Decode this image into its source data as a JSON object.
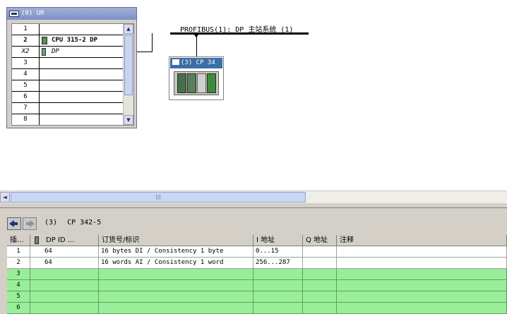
{
  "rack": {
    "title": "(0) UR",
    "rows": [
      {
        "slot": "1",
        "module": ""
      },
      {
        "slot": "2",
        "module": "CPU 315-2 DP",
        "icon": "cpu-module-icon"
      },
      {
        "slot": "X2",
        "module": "DP",
        "icon": "dp-interface-icon"
      },
      {
        "slot": "3",
        "module": ""
      },
      {
        "slot": "4",
        "module": ""
      },
      {
        "slot": "5",
        "module": ""
      },
      {
        "slot": "6",
        "module": ""
      },
      {
        "slot": "7",
        "module": ""
      },
      {
        "slot": "8",
        "module": ""
      }
    ]
  },
  "network": {
    "bus_label": "PROFIBUS(1): DP 主站系统 (1)",
    "slave_title": "(3) CP 34"
  },
  "detail": {
    "slot_number": "(3)",
    "module_name": "CP 342-5",
    "columns": [
      "插...",
      "DP ID ...",
      "订货号/标识",
      "I 地址",
      "Q 地址",
      "注释"
    ],
    "rows": [
      {
        "slot": "1",
        "dp_id": "64",
        "order": "16 bytes DI / Consistency 1 byte",
        "i_addr": "0...15",
        "q_addr": "",
        "comment": "",
        "highlight": false
      },
      {
        "slot": "2",
        "dp_id": "64",
        "order": "16 words AI / Consistency 1 word",
        "i_addr": "256...287",
        "q_addr": "",
        "comment": "",
        "highlight": false
      },
      {
        "slot": "3",
        "dp_id": "",
        "order": "",
        "i_addr": "",
        "q_addr": "",
        "comment": "",
        "highlight": true
      },
      {
        "slot": "4",
        "dp_id": "",
        "order": "",
        "i_addr": "",
        "q_addr": "",
        "comment": "",
        "highlight": true
      },
      {
        "slot": "5",
        "dp_id": "",
        "order": "",
        "i_addr": "",
        "q_addr": "",
        "comment": "",
        "highlight": true
      },
      {
        "slot": "6",
        "dp_id": "",
        "order": "",
        "i_addr": "",
        "q_addr": "",
        "comment": "",
        "highlight": true
      }
    ]
  },
  "colors": {
    "highlight_row": "#99ee99",
    "title_bar": "#7d90c4",
    "slave_title": "#3a6ea5"
  }
}
